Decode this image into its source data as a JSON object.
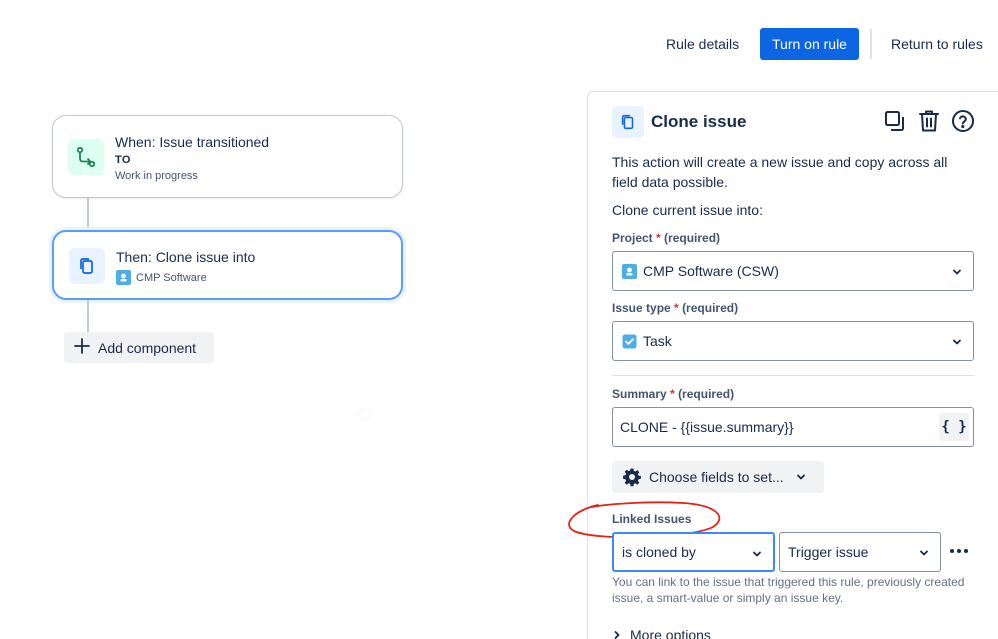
{
  "topbar": {
    "rule_details": "Rule details",
    "turn_on_rule": "Turn on rule",
    "return_to_rules": "Return to rules"
  },
  "flow": {
    "trigger": {
      "title": "When: Issue transitioned",
      "to_label": "TO",
      "status": "Work in progress",
      "icon": "transition-icon"
    },
    "action": {
      "title": "Then: Clone issue into",
      "project": "CMP Software",
      "icon": "clone-icon"
    },
    "add_component": "Add component"
  },
  "panel": {
    "title": "Clone issue",
    "description": "This action will create a new issue and copy across all field data possible.",
    "clone_into": "Clone current issue into:",
    "project": {
      "label": "Project",
      "required_marker": "*",
      "required_text": "(required)",
      "value": "CMP Software (CSW)"
    },
    "issue_type": {
      "label": "Issue type",
      "required_marker": "*",
      "required_text": "(required)",
      "value": "Task"
    },
    "summary": {
      "label": "Summary",
      "required_marker": "*",
      "required_text": "(required)",
      "value": "CLONE - {{issue.summary}}",
      "smart_value_button": "{ }"
    },
    "choose_fields": "Choose fields to set...",
    "linked_issues": {
      "label": "Linked Issues",
      "link_type": "is cloned by",
      "target": "Trigger issue",
      "help": "You can link to the issue that triggered this rule, previously created issue, a smart-value or simply an issue key."
    },
    "more_options": "More options"
  },
  "colors": {
    "primary": "#0c66e4",
    "focus_border": "#579dff",
    "annotation": "#e2231a",
    "trigger_icon_bg": "#dcfff1",
    "action_icon_bg": "#e9f2ff"
  }
}
